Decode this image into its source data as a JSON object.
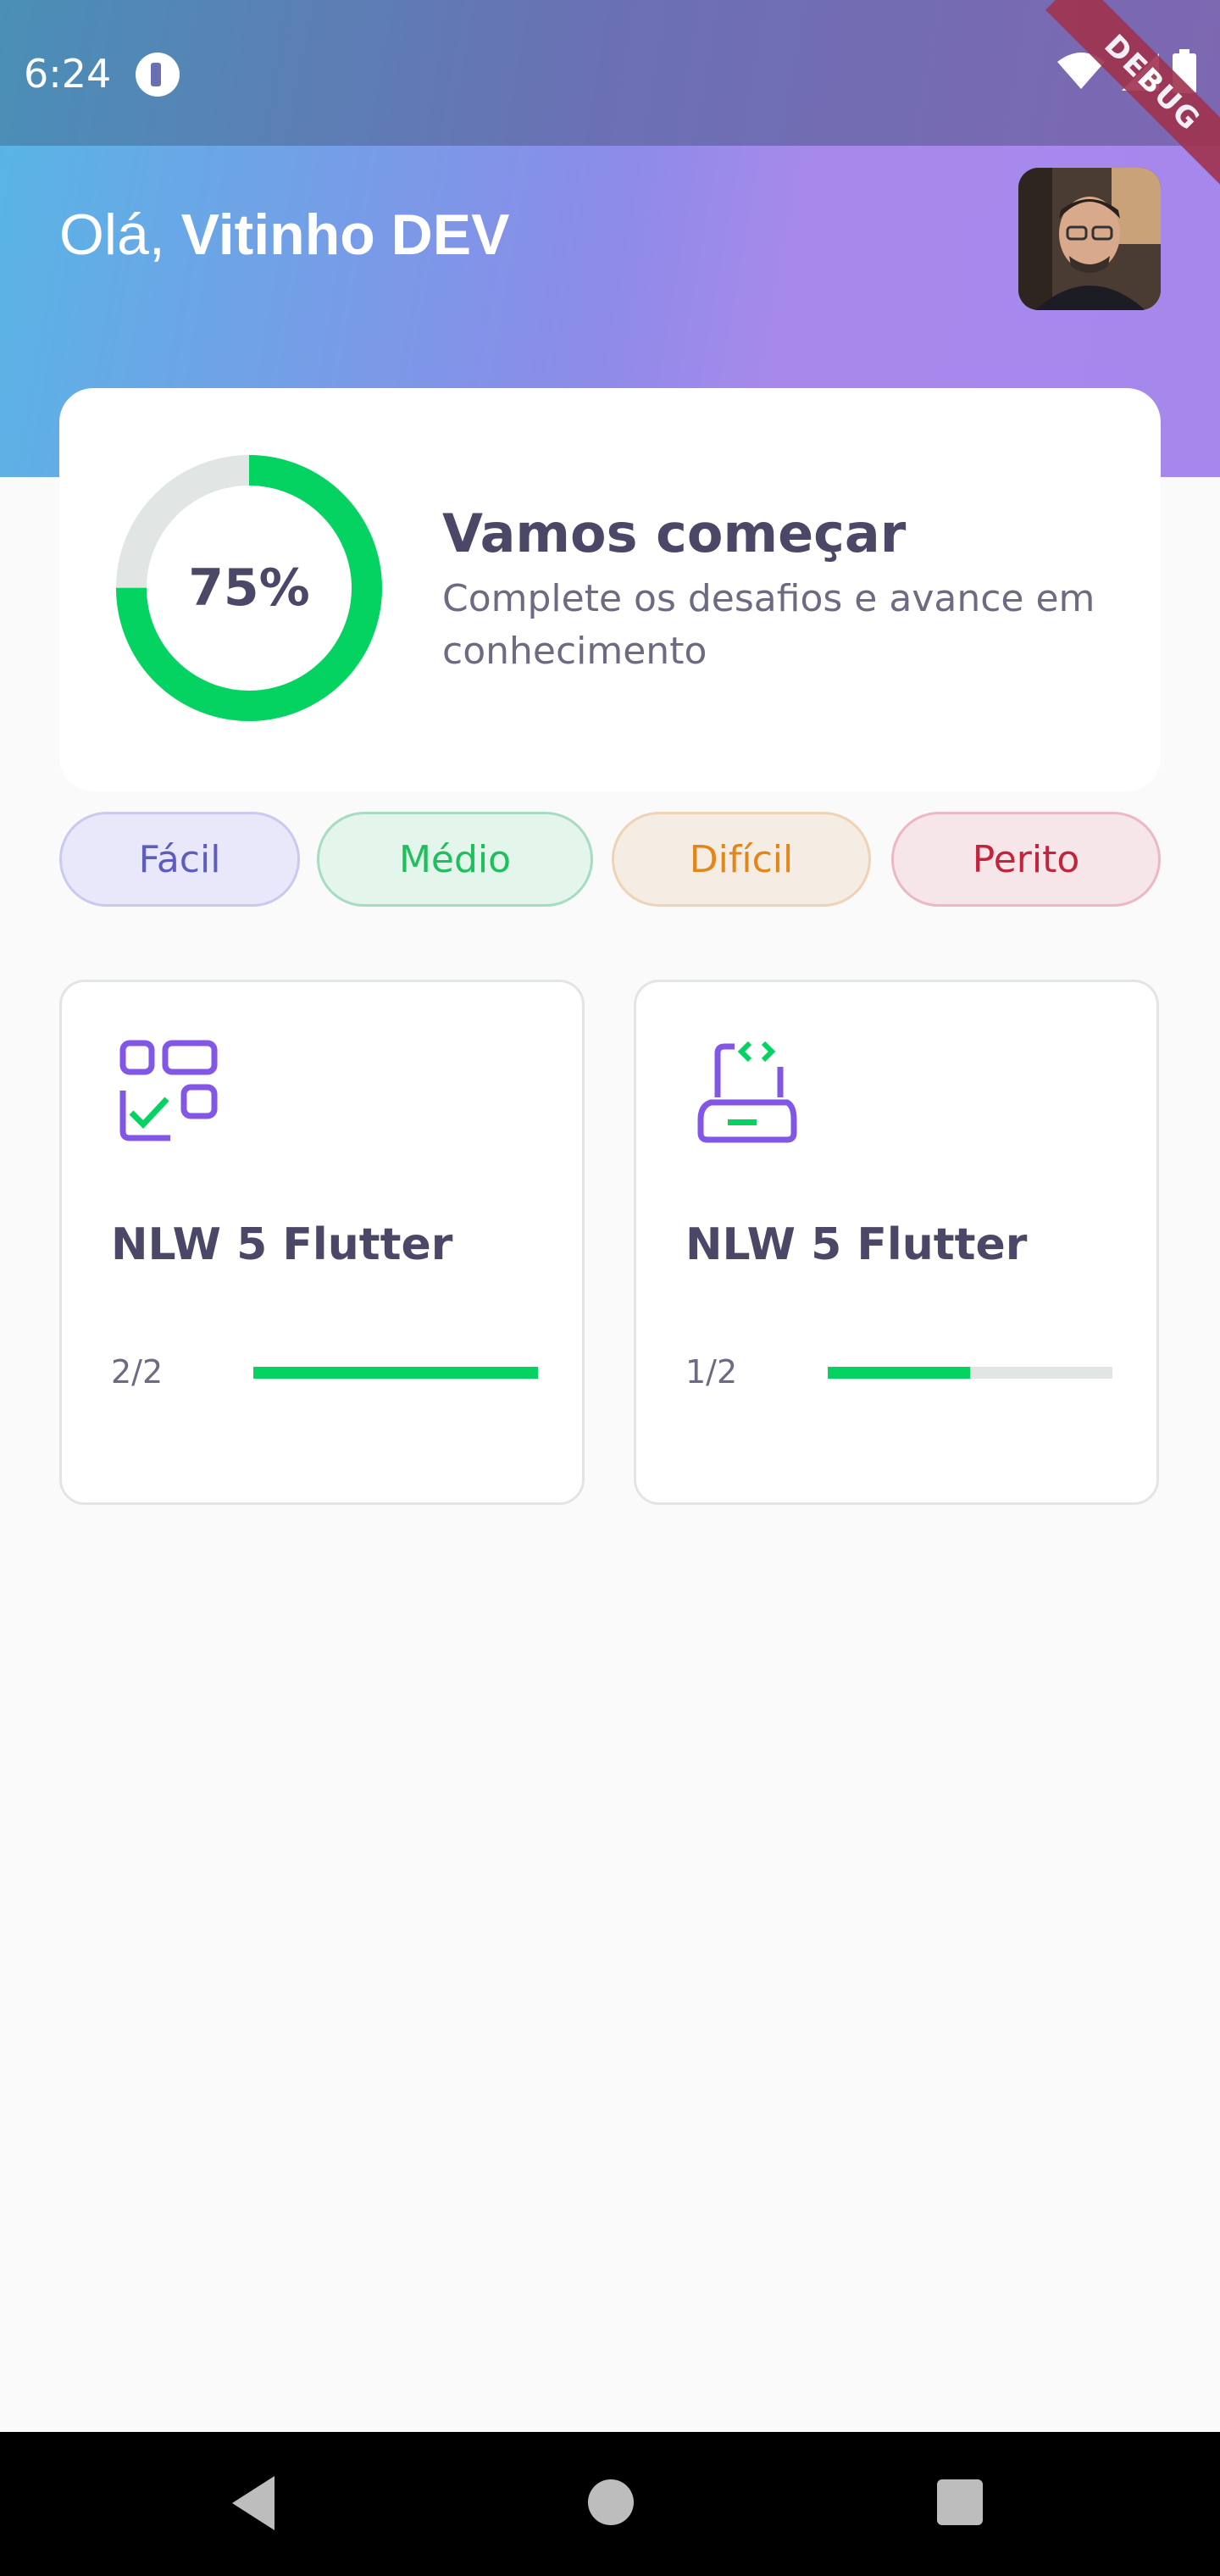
{
  "status_bar": {
    "time": "6:24",
    "debug_label": "DEBUG",
    "icons": [
      "app-notification-icon",
      "wifi-icon",
      "signal-icon",
      "battery-icon"
    ]
  },
  "header": {
    "greeting_prefix": "Olá, ",
    "user_name": "Vitinho DEV",
    "avatar": "user-avatar-photo"
  },
  "score_card": {
    "percent": 0.75,
    "percent_label": "75%",
    "title": "Vamos começar",
    "subtitle": "Complete os desafios e avance em conhecimento"
  },
  "levels": [
    {
      "label": "Fácil"
    },
    {
      "label": "Médio"
    },
    {
      "label": "Difícil"
    },
    {
      "label": "Perito"
    }
  ],
  "quizzes": [
    {
      "title": "NLW 5 Flutter",
      "progress_label": "2/2",
      "progress": 1.0,
      "icon": "blocks-icon"
    },
    {
      "title": "NLW 5 Flutter",
      "progress_label": "1/2",
      "progress": 0.5,
      "icon": "laptop-code-icon"
    }
  ],
  "colors": {
    "accent_green": "#04D361",
    "track_gray": "#E1E5E4",
    "text_dark": "#4B4766",
    "icon_purple": "#8257E5"
  },
  "nav": {
    "icons": [
      "back-icon",
      "home-icon",
      "recents-icon"
    ]
  }
}
